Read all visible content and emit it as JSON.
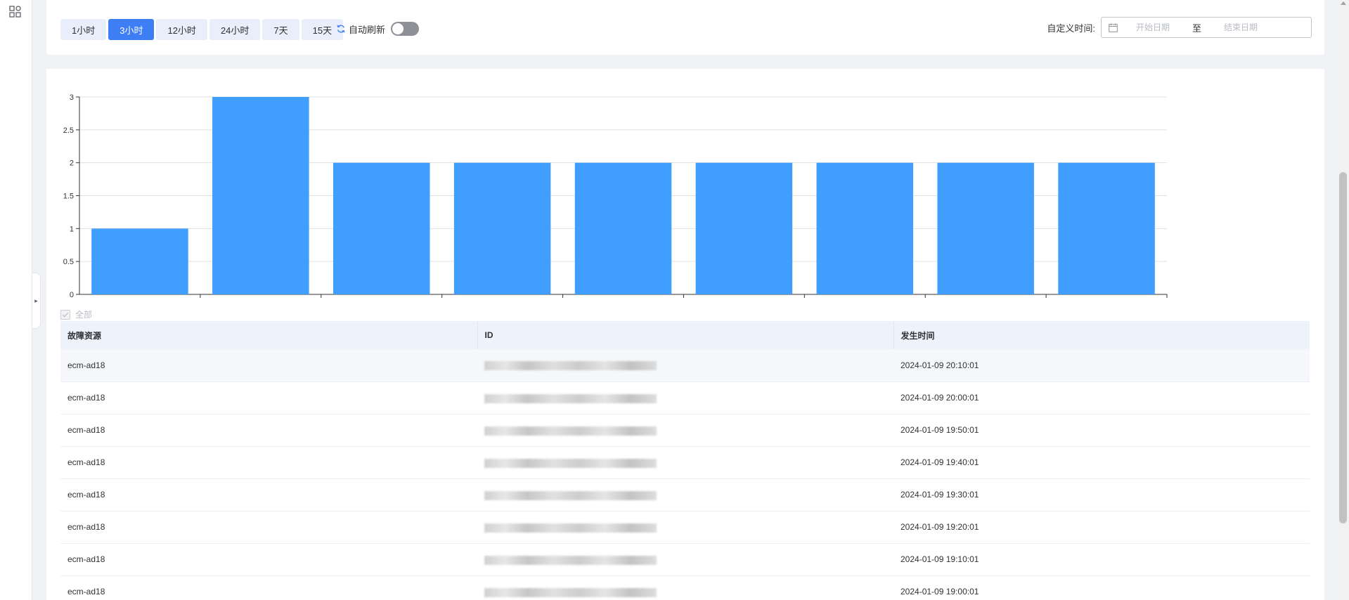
{
  "filter_bar": {
    "range_buttons": [
      {
        "label": "1小时",
        "active": false
      },
      {
        "label": "3小时",
        "active": true
      },
      {
        "label": "12小时",
        "active": false
      },
      {
        "label": "24小时",
        "active": false
      },
      {
        "label": "7天",
        "active": false
      },
      {
        "label": "15天",
        "active": false
      }
    ],
    "auto_refresh_label": "自动刷新",
    "auto_refresh_on": false,
    "custom_time_label": "自定义时间:",
    "start_placeholder": "开始日期",
    "end_placeholder": "结束日期",
    "range_separator": "至"
  },
  "colors": {
    "accent": "#3d7ef5",
    "bar": "#409eff",
    "button_bg": "#e8eefa"
  },
  "icons": {
    "rail": "grid-apps-icon",
    "refresh": "refresh-icon",
    "calendar": "calendar-icon",
    "collapse": "chevron-right-icon"
  },
  "chart_data": {
    "type": "bar",
    "categories": [
      "",
      "",
      "",
      "",
      "",
      "",
      "",
      "",
      ""
    ],
    "values": [
      1,
      3,
      2,
      2,
      2,
      2,
      2,
      2,
      2
    ],
    "ylim": [
      0,
      3
    ],
    "yticks": [
      "0",
      "0.5",
      "1",
      "1.5",
      "2",
      "2.5",
      "3"
    ],
    "grid": true,
    "title": "",
    "xlabel": "",
    "ylabel": ""
  },
  "table": {
    "select_all_label": "全部",
    "columns": [
      "故障资源",
      "ID",
      "发生时间"
    ],
    "rows": [
      {
        "resource": "ecm-ad18",
        "time": "2024-01-09 20:10:01"
      },
      {
        "resource": "ecm-ad18",
        "time": "2024-01-09 20:00:01"
      },
      {
        "resource": "ecm-ad18",
        "time": "2024-01-09 19:50:01"
      },
      {
        "resource": "ecm-ad18",
        "time": "2024-01-09 19:40:01"
      },
      {
        "resource": "ecm-ad18",
        "time": "2024-01-09 19:30:01"
      },
      {
        "resource": "ecm-ad18",
        "time": "2024-01-09 19:20:01"
      },
      {
        "resource": "ecm-ad18",
        "time": "2024-01-09 19:10:01"
      },
      {
        "resource": "ecm-ad18",
        "time": "2024-01-09 19:00:01"
      }
    ]
  }
}
